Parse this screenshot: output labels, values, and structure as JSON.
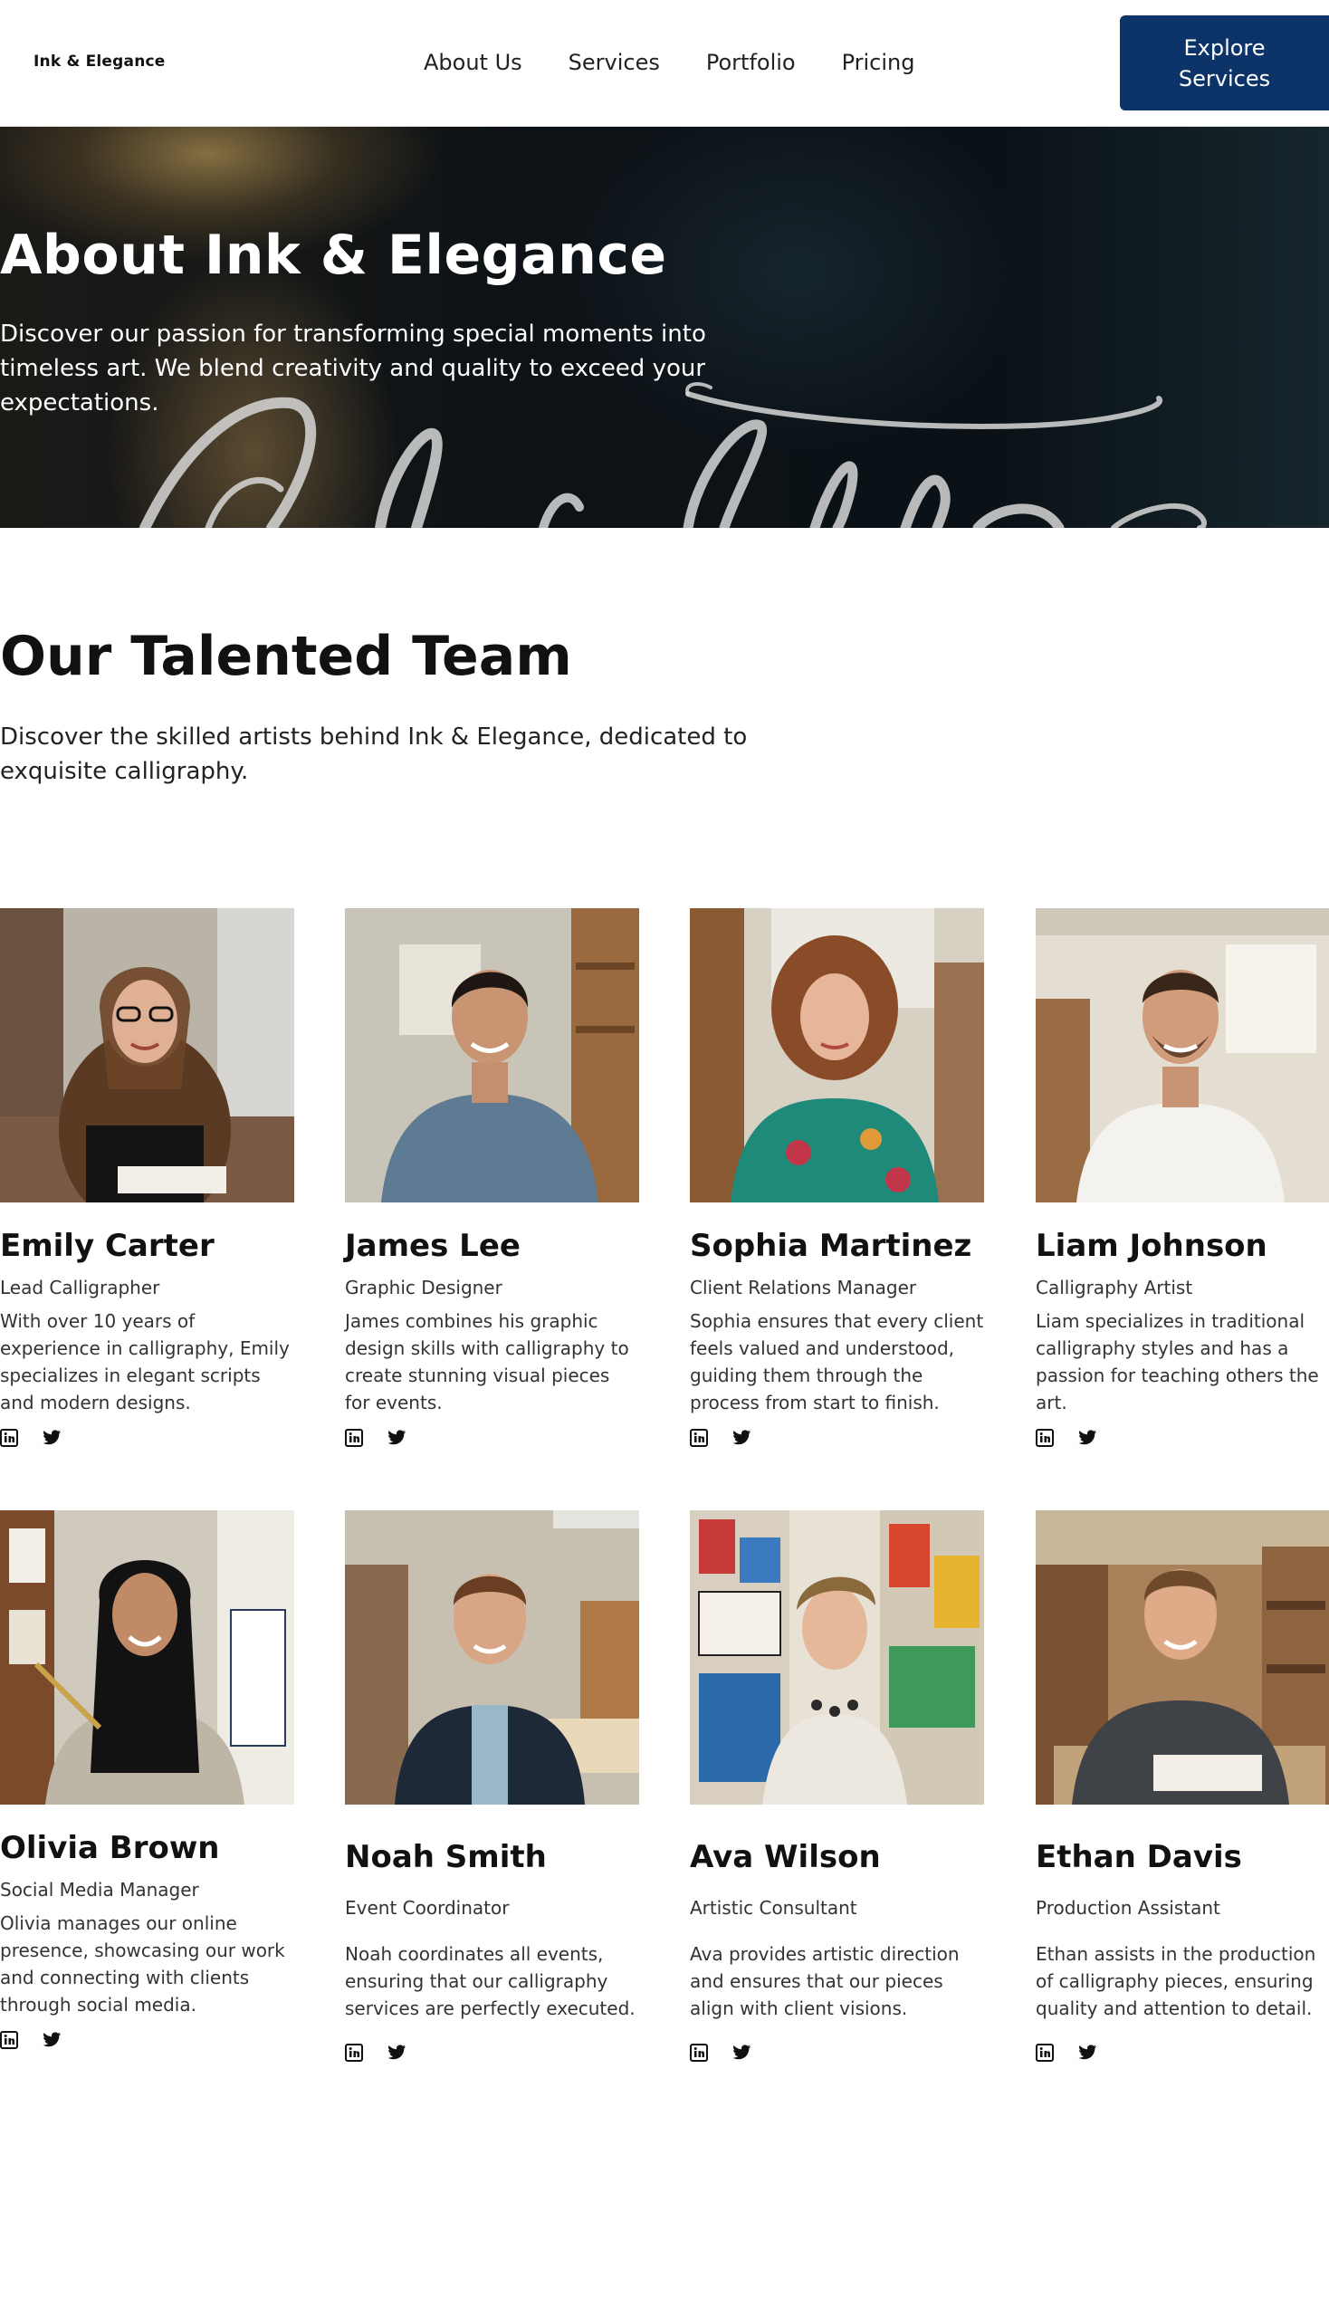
{
  "header": {
    "logo": "Ink & Elegance",
    "nav": [
      "About Us",
      "Services",
      "Portfolio",
      "Pricing"
    ],
    "cta": "Explore Services",
    "cta_color": "#0d3468"
  },
  "hero": {
    "title": "About Ink & Elegance",
    "text": "Discover our passion for transforming special moments into timeless art. We blend creativity and quality to exceed your expectations."
  },
  "team": {
    "title": "Our Talented Team",
    "subtitle": "Discover the skilled artists behind Ink & Elegance, dedicated to exquisite calligraphy.",
    "members": [
      {
        "name": "Emily Carter",
        "role": "Lead Calligrapher",
        "bio": "With over 10 years of experience in calligraphy, Emily specializes in elegant scripts and modern designs.",
        "photo_icon": "portrait-photo",
        "socials": [
          "linkedin-icon",
          "twitter-icon"
        ]
      },
      {
        "name": "James Lee",
        "role": "Graphic Designer",
        "bio": "James combines his graphic design skills with calligraphy to create stunning visual pieces for events.",
        "photo_icon": "portrait-photo",
        "socials": [
          "linkedin-icon",
          "twitter-icon"
        ]
      },
      {
        "name": "Sophia Martinez",
        "role": "Client Relations Manager",
        "bio": "Sophia ensures that every client feels valued and understood, guiding them through the process from start to finish.",
        "photo_icon": "portrait-photo",
        "socials": [
          "linkedin-icon",
          "twitter-icon"
        ]
      },
      {
        "name": "Liam Johnson",
        "role": "Calligraphy Artist",
        "bio": "Liam specializes in traditional calligraphy styles and has a passion for teaching others the art.",
        "photo_icon": "portrait-photo",
        "socials": [
          "linkedin-icon",
          "twitter-icon"
        ]
      },
      {
        "name": "Olivia Brown",
        "role": "Social Media Manager",
        "bio": "Olivia manages our online presence, showcasing our work and connecting with clients through social media.",
        "photo_icon": "portrait-photo",
        "socials": [
          "linkedin-icon",
          "twitter-icon"
        ]
      },
      {
        "name": "Noah Smith",
        "role": "Event Coordinator",
        "bio": "Noah coordinates all events, ensuring that our calligraphy services are perfectly executed.",
        "photo_icon": "portrait-photo",
        "socials": [
          "linkedin-icon",
          "twitter-icon"
        ]
      },
      {
        "name": "Ava Wilson",
        "role": "Artistic Consultant",
        "bio": "Ava provides artistic direction and ensures that our pieces align with client visions.",
        "photo_icon": "portrait-photo",
        "socials": [
          "linkedin-icon",
          "twitter-icon"
        ]
      },
      {
        "name": "Ethan Davis",
        "role": "Production Assistant",
        "bio": "Ethan assists in the production of calligraphy pieces, ensuring quality and attention to detail.",
        "photo_icon": "portrait-photo",
        "socials": [
          "linkedin-icon",
          "twitter-icon"
        ]
      }
    ]
  }
}
